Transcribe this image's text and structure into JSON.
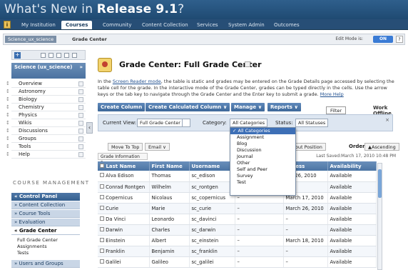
{
  "banner": {
    "title_prefix": "What's New in ",
    "title_bold": "Release 9.1",
    "title_suffix": "?"
  },
  "tabs": [
    "My Institution",
    "Courses",
    "Community",
    "Content Collection",
    "Services",
    "System Admin",
    "Outcomes"
  ],
  "active_tab": "Courses",
  "breadcrumb": {
    "course": "Science_ux_science",
    "page": "Grade Center",
    "edit_mode_label": "Edit Mode is:",
    "edit_mode_value": "ON",
    "help": "?"
  },
  "course_menu": {
    "title": "Science (ux_science)",
    "items": [
      "Overview",
      "Astronomy",
      "Biology",
      "Chemistry",
      "Physics",
      "Wikis",
      "Discussions",
      "Groups",
      "Tools",
      "Help"
    ]
  },
  "course_management": {
    "title": "COURSE MANAGEMENT",
    "control_panel": "Control Panel",
    "items": [
      "Content Collection",
      "Course Tools",
      "Evaluation",
      "Grade Center"
    ],
    "grade_center_sub": [
      "Full Grade Center",
      "Assignments",
      "Tests"
    ],
    "last_item": "Users and Groups"
  },
  "page": {
    "title": "Grade Center: Full Grade Center",
    "description_1": "In the ",
    "description_link": "Screen Reader mode",
    "description_2": ", the table is static and grades may be entered on the Grade Details page accessed by selecting the table cell for the grade. In the interactive mode of the Grade Center, grades can be typed directly in the cells. Use the arrow keys or the tab key to navigate through the Grade Center and the Enter key to submit a grade. ",
    "more_help": "More Help"
  },
  "actions": [
    "Create Column",
    "Create Calculated Column",
    "Manage",
    "Reports"
  ],
  "work_offline": "Work Offline",
  "filter_label": "Filter",
  "viewbar": {
    "current_view_label": "Current View:",
    "current_view_value": "Full Grade Center",
    "category_label": "Category:",
    "category_value": "All Categories",
    "status_label": "Status:",
    "status_value": "All Statuses"
  },
  "category_options": [
    "All Categories",
    "Assignment",
    "Blog",
    "Discussion",
    "Journal",
    "Other",
    "Self and Peer",
    "Survey",
    "Test"
  ],
  "toolbar": {
    "move_to_top": "Move To Top",
    "email": "Email",
    "layout_position": "yout Position",
    "order_label": "Order:",
    "order_value": "Ascending"
  },
  "grade_info_bar": "Grade Information Bar",
  "last_saved": "Last Saved:March 17, 2010 10:48 PM",
  "table": {
    "headers": [
      "Last Name",
      "First Name",
      "Username",
      "",
      "Access",
      "Availability"
    ],
    "rows": [
      [
        "Alva Edison",
        "Thomas",
        "sc_edison",
        "–",
        "rch 26, 2010",
        "Available"
      ],
      [
        "Conrad Rontgen",
        "Wilhelm",
        "sc_rontgen",
        "–",
        "",
        "Available"
      ],
      [
        "Copernicus",
        "Nicolaus",
        "sc_copernicus",
        "–",
        "March 17, 2010",
        "Available"
      ],
      [
        "Curie",
        "Marie",
        "sc_curie",
        "–",
        "March 26, 2010",
        "Available"
      ],
      [
        "Da Vinci",
        "Leonardo",
        "sc_davinci",
        "–",
        "–",
        "Available"
      ],
      [
        "Darwin",
        "Charles",
        "sc_darwin",
        "–",
        "–",
        "Available"
      ],
      [
        "Einstein",
        "Albert",
        "sc_einstein",
        "–",
        "March 18, 2010",
        "Available"
      ],
      [
        "Franklin",
        "Benjamin",
        "sc_franklin",
        "–",
        "–",
        "Available"
      ],
      [
        "Galilei",
        "Galileo",
        "sc_galilei",
        "–",
        "–",
        "Available"
      ]
    ]
  }
}
